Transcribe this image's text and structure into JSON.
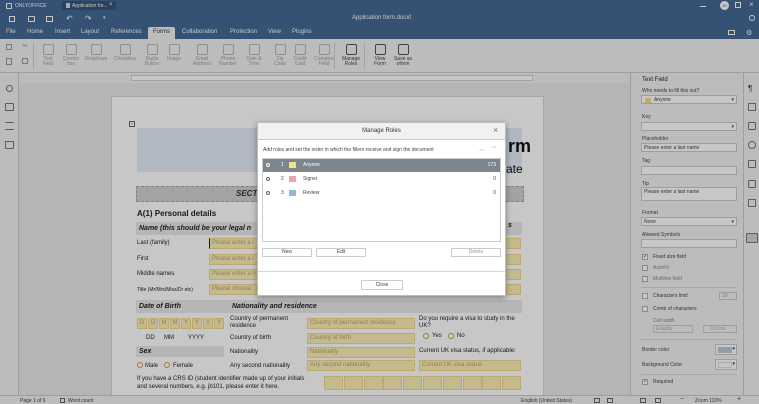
{
  "title_bar": {
    "brand": "ONLYOFFICE",
    "tab_title": "Application for...",
    "doc_title": "Application form.docxf",
    "avatar_initials": "JD"
  },
  "menu": [
    "File",
    "Home",
    "Insert",
    "Layout",
    "References",
    "Forms",
    "Collaboration",
    "Protection",
    "View",
    "Plugins"
  ],
  "menu_active": "Forms",
  "toolbar": {
    "items": [
      {
        "label1": "Text",
        "label2": "Field",
        "on": false
      },
      {
        "label1": "Combo",
        "label2": "box",
        "on": false
      },
      {
        "label1": "Dropdown",
        "label2": "",
        "on": false
      },
      {
        "label1": "Checkbox",
        "label2": "",
        "on": false
      },
      {
        "label1": "Radio",
        "label2": "Button",
        "on": false
      },
      {
        "label1": "Image",
        "label2": "",
        "on": false
      },
      {
        "label1": "Email",
        "label2": "Address",
        "on": false
      },
      {
        "label1": "Phone",
        "label2": "Number",
        "on": false
      },
      {
        "label1": "Date &",
        "label2": "Time",
        "on": false
      },
      {
        "label1": "Zip",
        "label2": "Code",
        "on": false
      },
      {
        "label1": "Credit",
        "label2": "Card",
        "on": false
      },
      {
        "label1": "Complex",
        "label2": "Field",
        "on": false
      },
      {
        "label1": "Manage",
        "label2": "Roles",
        "on": true
      },
      {
        "label1": "View",
        "label2": "Form",
        "on": true
      },
      {
        "label1": "Save as",
        "label2": "oform",
        "on": true
      }
    ]
  },
  "document": {
    "heading_tail": "rm",
    "subheading_tail": "ate",
    "section_tail": "SECT",
    "section_a1": "A(1) Personal details",
    "name_note": "Name (this should be your legal n",
    "name_note_tail": "s",
    "fields": {
      "last": {
        "label": "Last (family)",
        "value": "Please enter a l"
      },
      "first": {
        "label": "First",
        "value": "Please enter a l"
      },
      "middle": {
        "label": "Middle names",
        "value": "Please enter a n"
      },
      "title": {
        "label": "Title (Mr/Mrs/Miss/Dr etc)",
        "value": "Please choose"
      }
    },
    "dob_label": "Date of Birth",
    "nat_label": "Nationality and residence",
    "dob_boxes": [
      "D",
      "D",
      "M",
      "M",
      "Y",
      "Y",
      "Y",
      "Y"
    ],
    "dob_format": [
      "DD",
      "MM",
      "YYYY"
    ],
    "country_perm_label": "Country of permanent residence",
    "country_perm_value": "Country of permanent residence",
    "country_birth_label": "Country of birth",
    "country_birth_value": "Country of birth",
    "nationality_label": "Nationality",
    "nationality_value": "Nationality",
    "second_nat_label": "Any second nationality",
    "second_nat_value": "Any second nationality",
    "visa_question": "Do you require a visa to study in the UK?",
    "yes": "Yes",
    "no": "No",
    "visa_status_label": "Current UK visa status, if applicable:",
    "visa_status_value": "Current UK visa status",
    "sex_label": "Sex",
    "male": "Male",
    "female": "Female",
    "crs_text_1": "If you have a CRS ID (student identifier made up of your initials",
    "crs_text_2": "and several numbers, e.g. jb101, please enter it here."
  },
  "dialog": {
    "title": "Manage Roles",
    "description": "Add roles and set the order in which the fillers receive and sign the document",
    "roles": [
      {
        "num": "1",
        "name": "Anyone",
        "count": "173",
        "color": "#f3e08a",
        "selected": true
      },
      {
        "num": "2",
        "name": "Signer",
        "count": "0",
        "color": "#e6a6b6",
        "selected": false
      },
      {
        "num": "3",
        "name": "Review",
        "count": "0",
        "color": "#9ab6d6",
        "selected": false
      }
    ],
    "new_btn": "New",
    "edit_btn": "Edit",
    "delete_btn": "Delete",
    "close_btn": "Close"
  },
  "panel": {
    "title": "Text Field",
    "who_label": "Who needs to fill this out?",
    "who_value": "Anyone",
    "key_label": "Key",
    "placeholder_label": "Placeholder",
    "placeholder_value": "Please enter a last name",
    "tag_label": "Tag",
    "tip_label": "Tip",
    "tip_value": "Please enter a last name",
    "format_label": "Format",
    "format_value": "None",
    "allowed_label": "Allowed Symbols",
    "fixed_size": "Fixed size field",
    "autofit": "AutoFit",
    "multiline": "Multiline field",
    "char_limit": "Characters limit",
    "char_limit_value": "10",
    "comb": "Comb of characters",
    "cell_width": "Cell width",
    "cell_width_mode": "Exactly",
    "cell_width_value": "0.0 cm",
    "border_color": "Border color",
    "border_color_hex": "#b9cbd8",
    "background_color": "Background Color",
    "background_color_hex": "#ffffff",
    "required": "Required"
  },
  "status_bar": {
    "page": "Page 1 of 6",
    "word_count": "Word count",
    "language": "English (United States)",
    "zoom": "Zoom 110%"
  }
}
